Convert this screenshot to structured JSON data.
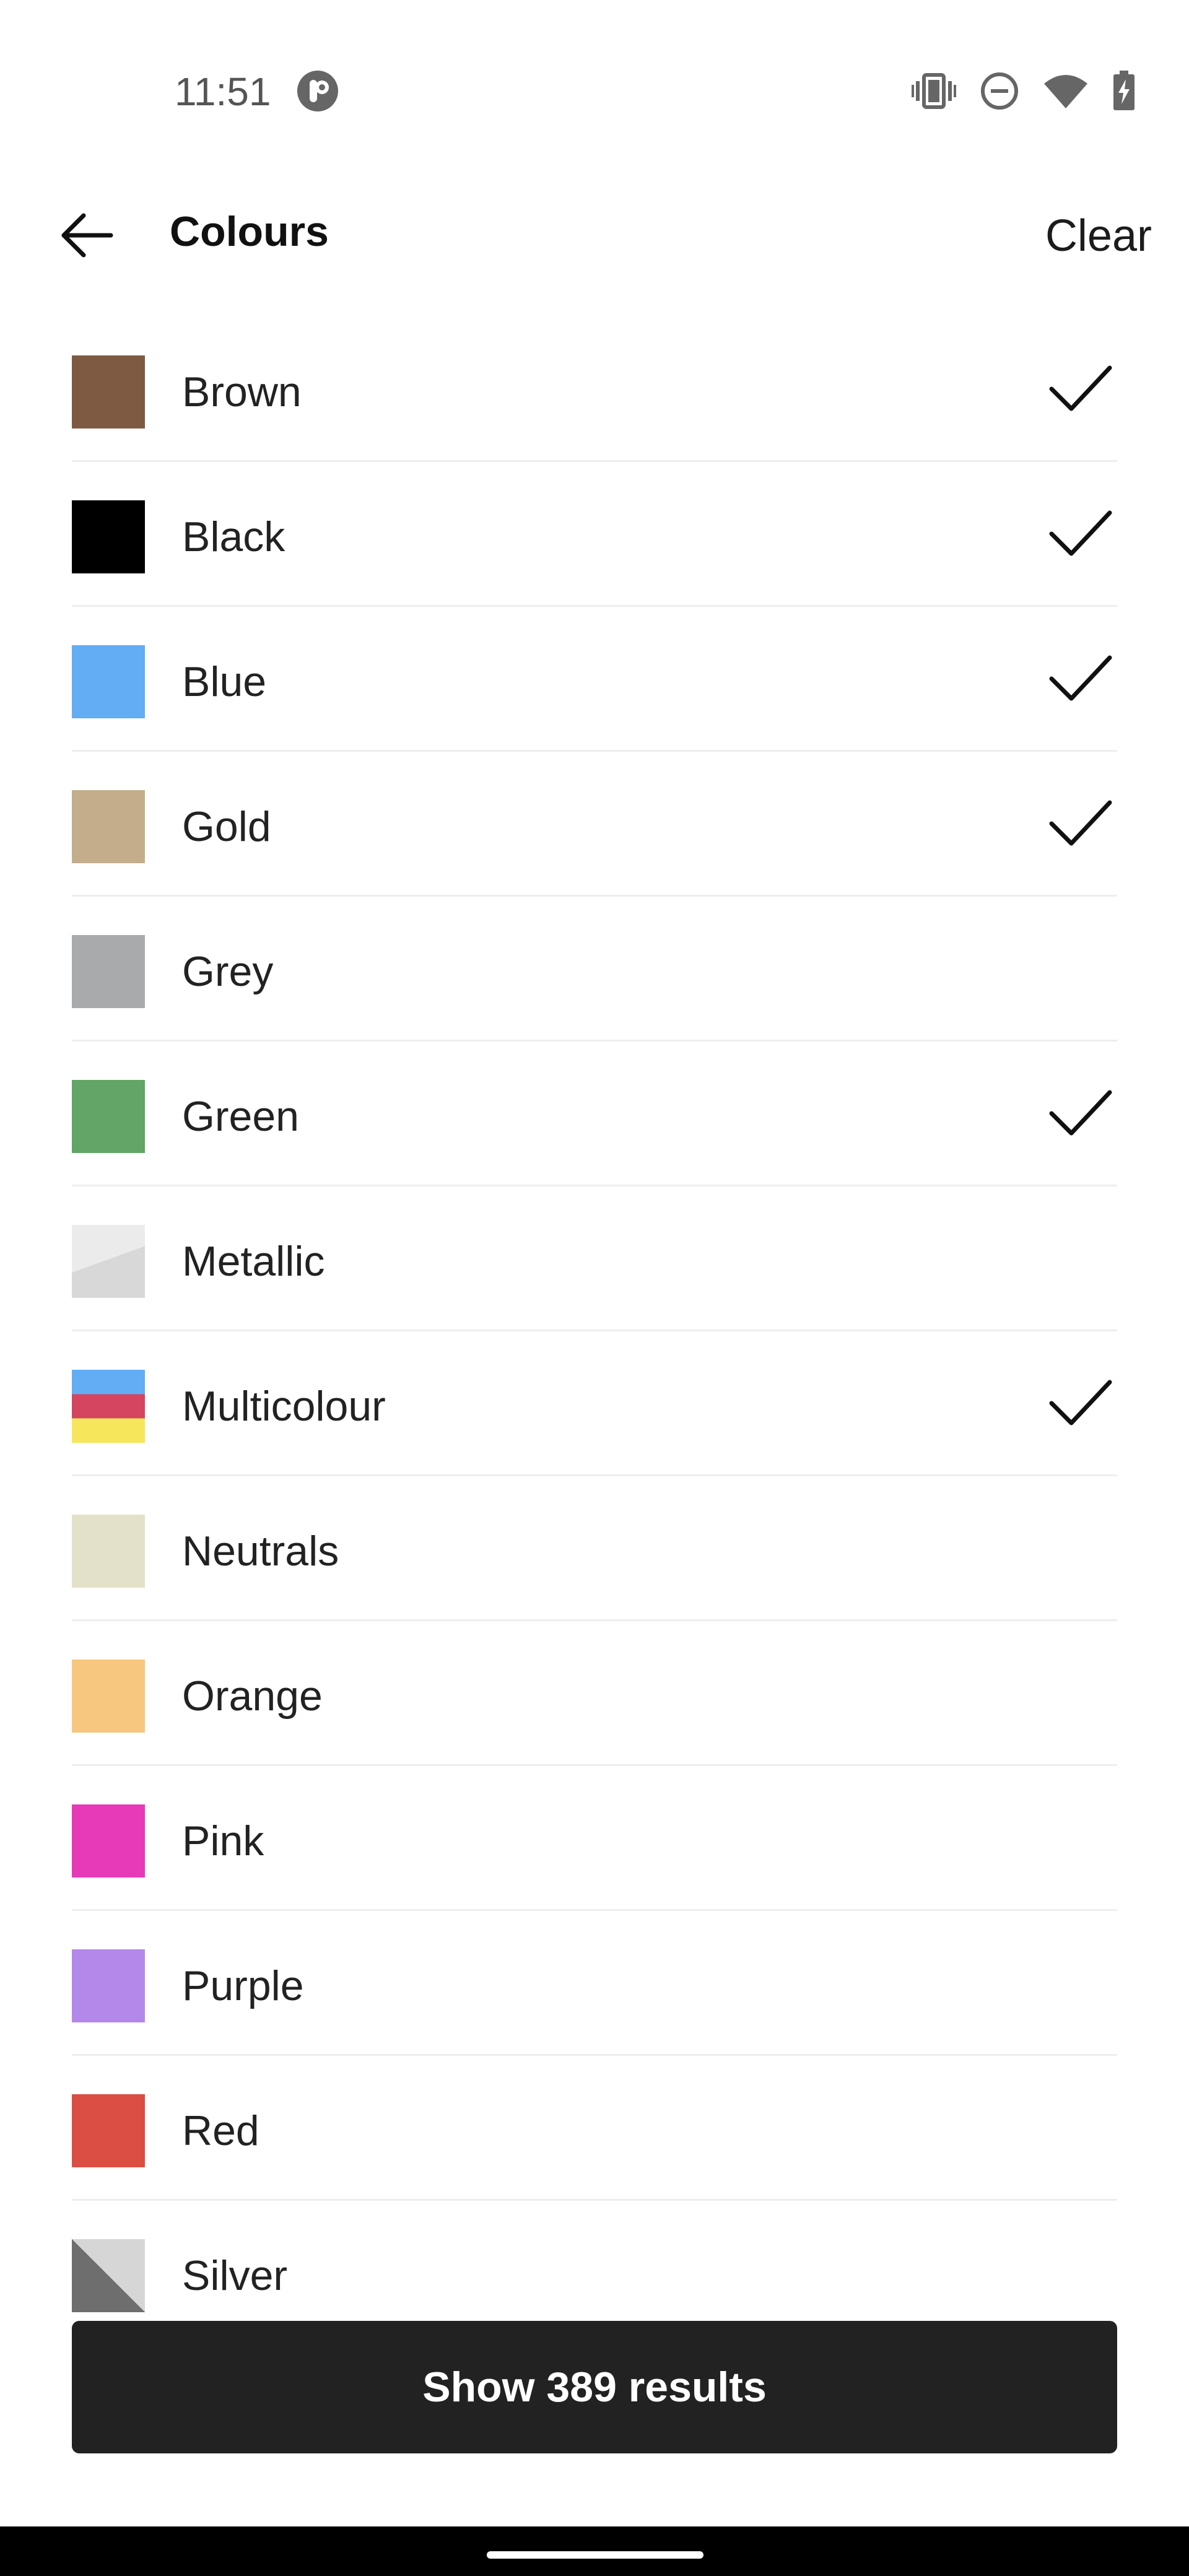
{
  "status_bar": {
    "time": "11:51",
    "app_icon": "pinterest-like-icon",
    "icons": [
      "vibrate-icon",
      "do-not-disturb-icon",
      "wifi-icon",
      "battery-charging-icon"
    ]
  },
  "header": {
    "title": "Colours",
    "back_icon": "arrow-left-icon",
    "clear_label": "Clear"
  },
  "colours": [
    {
      "label": "Brown",
      "swatch": "#7e5a43",
      "selected": true
    },
    {
      "label": "Black",
      "swatch": "#000000",
      "selected": true
    },
    {
      "label": "Blue",
      "swatch": "#62adf4",
      "selected": true
    },
    {
      "label": "Gold",
      "swatch": "#c3ad8b",
      "selected": true
    },
    {
      "label": "Grey",
      "swatch": "#a9aaab",
      "selected": false
    },
    {
      "label": "Green",
      "swatch": "#62a566",
      "selected": true
    },
    {
      "label": "Metallic",
      "swatch": "metallic",
      "selected": false
    },
    {
      "label": "Multicolour",
      "swatch": "multicolour",
      "selected": true
    },
    {
      "label": "Neutrals",
      "swatch": "#e3e1c9",
      "selected": false
    },
    {
      "label": "Orange",
      "swatch": "#f7c67f",
      "selected": false
    },
    {
      "label": "Pink",
      "swatch": "#e63ab9",
      "selected": false
    },
    {
      "label": "Purple",
      "swatch": "#b488ea",
      "selected": false
    },
    {
      "label": "Red",
      "swatch": "#da4e44",
      "selected": false
    },
    {
      "label": "Silver",
      "swatch": "silver",
      "selected": false
    }
  ],
  "footer": {
    "button_label": "Show 389 results"
  },
  "colors": {
    "button_bg": "#222222",
    "divider": "#eeeeee",
    "text": "#222222"
  }
}
